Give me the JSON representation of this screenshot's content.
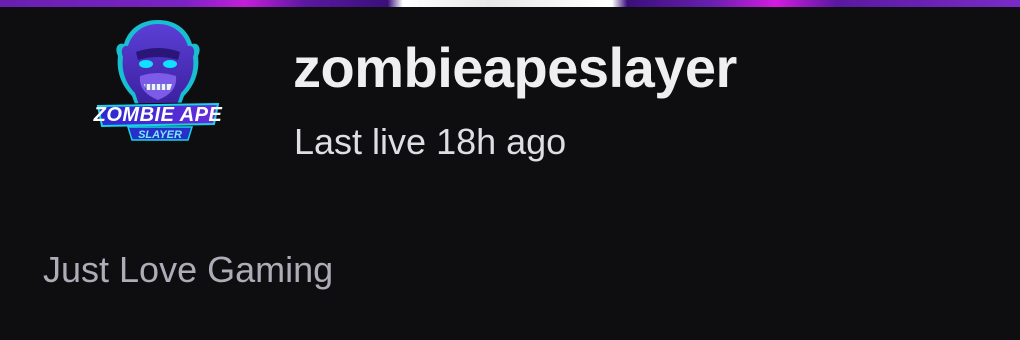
{
  "channel": {
    "name": "zombieapeslayer",
    "last_live": "Last live 18h ago",
    "bio": "Just Love Gaming"
  },
  "avatar": {
    "logo_text_top": "ZOMBIE APE",
    "logo_text_bottom": "SLAYER",
    "icon": "zombie-ape-logo"
  },
  "colors": {
    "background": "#0e0e10",
    "name_text": "#efeff1",
    "secondary_text": "#dedee3",
    "bio_text": "#adadb8",
    "accent_purple": "#7b2bc8"
  }
}
